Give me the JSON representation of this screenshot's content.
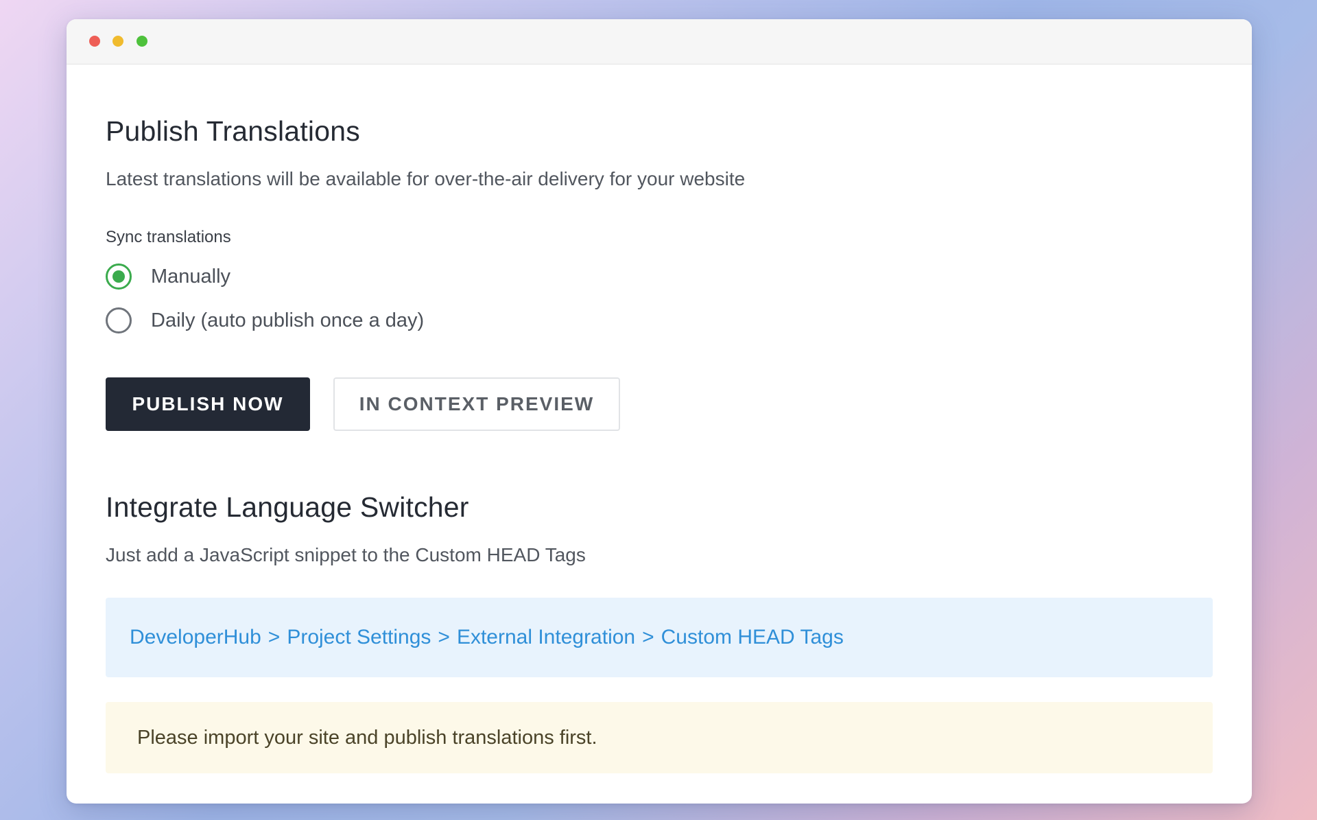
{
  "window": {
    "controls": [
      "close",
      "minimize",
      "zoom"
    ]
  },
  "publish": {
    "title": "Publish Translations",
    "description": "Latest translations will be available for over-the-air delivery for your website",
    "sync_label": "Sync translations",
    "options": [
      {
        "label": "Manually",
        "selected": true
      },
      {
        "label": "Daily (auto publish once a day)",
        "selected": false
      }
    ],
    "publish_button": "PUBLISH NOW",
    "preview_button": "IN CONTEXT PREVIEW"
  },
  "integrate": {
    "title": "Integrate Language Switcher",
    "description": "Just add a JavaScript snippet to the Custom HEAD Tags",
    "path": [
      "DeveloperHub",
      "Project Settings",
      "External Integration",
      "Custom HEAD Tags"
    ],
    "path_separator": ">",
    "notice": "Please import your site and publish translations first."
  },
  "colors": {
    "accent_green": "#3bab4d",
    "primary_button": "#232935",
    "link_blue": "#2f8fd8",
    "info_bg": "#e8f3fd",
    "warning_bg": "#fdf9e9"
  }
}
